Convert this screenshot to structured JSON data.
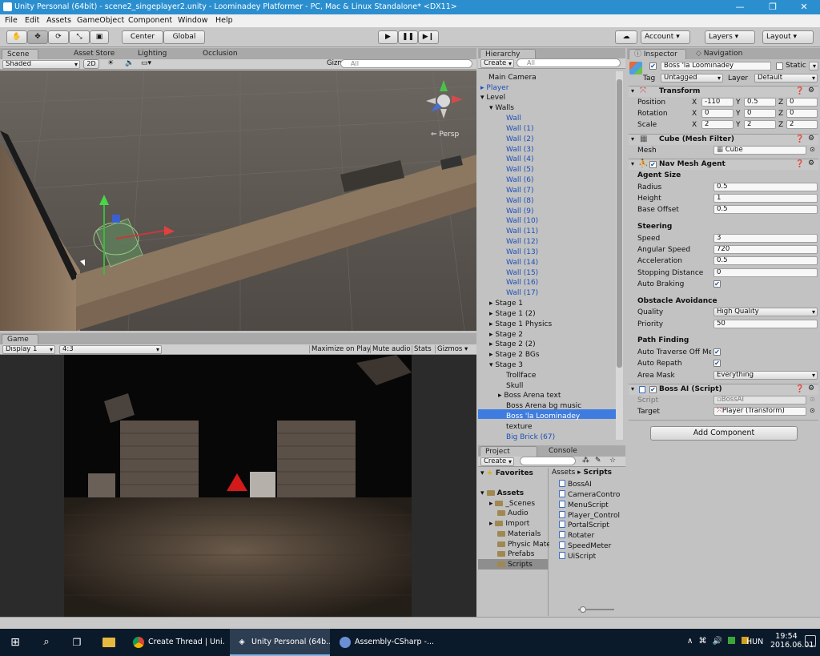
{
  "window": {
    "title": "Unity Personal (64bit) - scene2_singeplayer2.unity - Loominadey Platformer - PC, Mac & Linux Standalone* <DX11>"
  },
  "menu": [
    "File",
    "Edit",
    "Assets",
    "GameObject",
    "Component",
    "Window",
    "Help"
  ],
  "toolbar": {
    "center": "Center",
    "global": "Global",
    "account": "Account",
    "layers": "Layers",
    "layout": "Layout"
  },
  "scene": {
    "tabs": [
      "Scene",
      "Asset Store",
      "Lighting",
      "Occlusion"
    ],
    "shading": "Shaded",
    "mode2d": "2D",
    "gizmos": "Gizmos",
    "search_placeholder": "All",
    "persp": "Persp"
  },
  "game": {
    "tab": "Game",
    "display": "Display 1",
    "aspect": "4:3",
    "buttons": [
      "Maximize on Play",
      "Mute audio",
      "Stats",
      "Gizmos"
    ]
  },
  "hierarchy": {
    "tab": "Hierarchy",
    "create": "Create",
    "search_placeholder": "All",
    "items": [
      {
        "label": "Main Camera"
      },
      {
        "label": "Player"
      },
      {
        "label": "Level"
      },
      {
        "label": "Walls"
      },
      {
        "label": "Wall"
      },
      {
        "label": "Wall (1)"
      },
      {
        "label": "Wall (2)"
      },
      {
        "label": "Wall (3)"
      },
      {
        "label": "Wall (4)"
      },
      {
        "label": "Wall (5)"
      },
      {
        "label": "Wall (6)"
      },
      {
        "label": "Wall (7)"
      },
      {
        "label": "Wall (8)"
      },
      {
        "label": "Wall (9)"
      },
      {
        "label": "Wall (10)"
      },
      {
        "label": "Wall (11)"
      },
      {
        "label": "Wall (12)"
      },
      {
        "label": "Wall (13)"
      },
      {
        "label": "Wall (14)"
      },
      {
        "label": "Wall (15)"
      },
      {
        "label": "Wall (16)"
      },
      {
        "label": "Wall (17)"
      },
      {
        "label": "Stage 1"
      },
      {
        "label": "Stage 1 (2)"
      },
      {
        "label": "Stage 1 Physics"
      },
      {
        "label": "Stage 2"
      },
      {
        "label": "Stage 2 (2)"
      },
      {
        "label": "Stage 2 BGs"
      },
      {
        "label": "Stage 3"
      },
      {
        "label": "Trollface"
      },
      {
        "label": "Skull"
      },
      {
        "label": "Boss Arena text"
      },
      {
        "label": "Boss Arena bg music"
      },
      {
        "label": "Boss 'la Loominadey"
      },
      {
        "label": "texture"
      },
      {
        "label": "Big Brick (67)"
      }
    ]
  },
  "project": {
    "tabs": [
      "Project",
      "Console"
    ],
    "create": "Create",
    "favorites": "Favorites",
    "assets": "Assets",
    "folders": [
      "_Scenes",
      "Audio",
      "Import",
      "Materials",
      "Physic Mate",
      "Prefabs",
      "Scripts"
    ],
    "breadcrumb": [
      "Assets",
      "Scripts"
    ],
    "files": [
      "BossAI",
      "CameraContro",
      "MenuScript",
      "Player_Control",
      "PortalScript",
      "Rotater",
      "SpeedMeter",
      "UiScript"
    ]
  },
  "inspector": {
    "tabs": [
      "Inspector",
      "Navigation"
    ],
    "object_name": "Boss 'la Loominadey",
    "static_label": "Static",
    "tag_label": "Tag",
    "tag_value": "Untagged",
    "layer_label": "Layer",
    "layer_value": "Default",
    "transform": {
      "title": "Transform",
      "position_label": "Position",
      "rotation_label": "Rotation",
      "scale_label": "Scale",
      "x": "X",
      "y": "Y",
      "z": "Z",
      "position": [
        "-110",
        "0.5",
        "0"
      ],
      "rotation": [
        "0",
        "0",
        "0"
      ],
      "scale": [
        "2",
        "2",
        "2"
      ]
    },
    "mesh_filter": {
      "title": "Cube (Mesh Filter)",
      "mesh_label": "Mesh",
      "mesh_value": "Cube"
    },
    "nav_agent": {
      "title": "Nav Mesh Agent",
      "agent_size": "Agent Size",
      "radius_label": "Radius",
      "radius": "0.5",
      "height_label": "Height",
      "height": "1",
      "base_offset_label": "Base Offset",
      "base_offset": "0.5",
      "steering": "Steering",
      "speed_label": "Speed",
      "speed": "3",
      "angular_speed_label": "Angular Speed",
      "angular_speed": "720",
      "acceleration_label": "Acceleration",
      "acceleration": "0.5",
      "stopping_distance_label": "Stopping Distance",
      "stopping_distance": "0",
      "auto_braking_label": "Auto Braking",
      "obstacle_avoidance": "Obstacle Avoidance",
      "quality_label": "Quality",
      "quality": "High Quality",
      "priority_label": "Priority",
      "priority": "50",
      "path_finding": "Path Finding",
      "auto_traverse_label": "Auto Traverse Off Me",
      "auto_repath_label": "Auto Repath",
      "area_mask_label": "Area Mask",
      "area_mask": "Everything"
    },
    "boss_ai": {
      "title": "Boss AI (Script)",
      "script_label": "Script",
      "script_value": "BossAI",
      "target_label": "Target",
      "target_value": "Player (Transform)"
    },
    "add_component": "Add Component"
  },
  "taskbar": {
    "tasks": [
      "Create Thread | Uni...",
      "Unity Personal (64b...",
      "Assembly-CSharp -..."
    ],
    "language": "HUN",
    "time": "19:54",
    "date": "2016.06.01."
  },
  "colors": {
    "title_blue": "#2b8fcf",
    "selection_blue": "#3e7ce0",
    "taskbar": "#0b1a2b"
  }
}
